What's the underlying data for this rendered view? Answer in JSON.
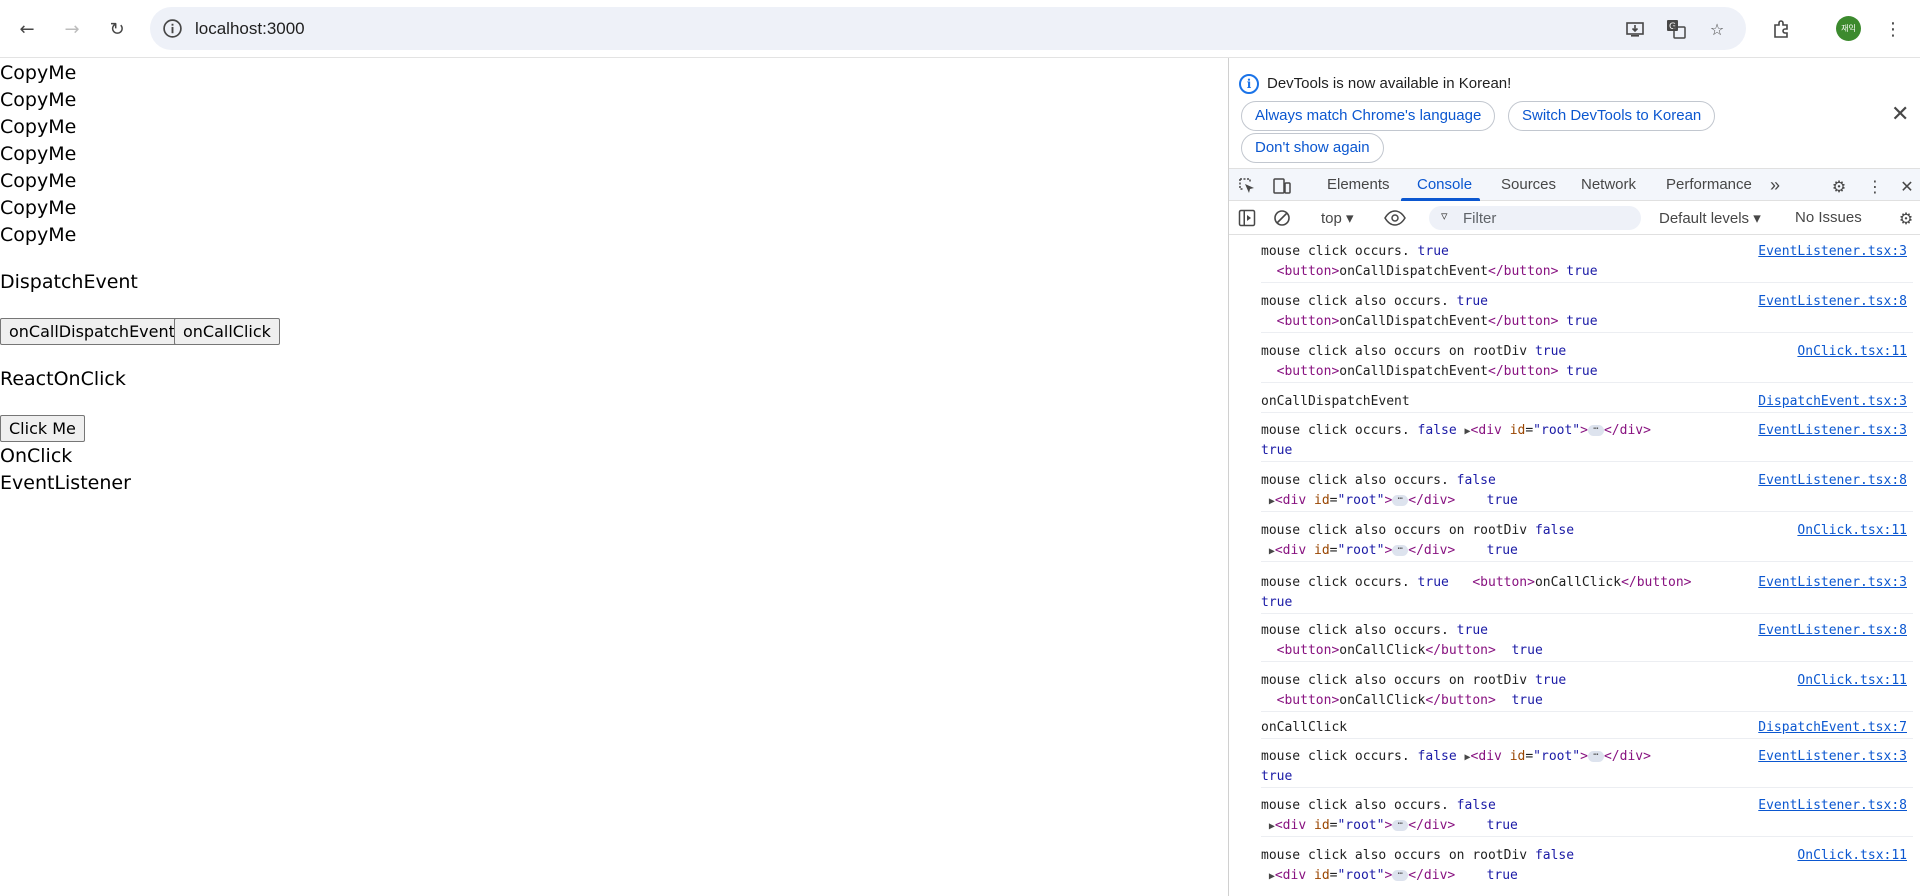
{
  "browser": {
    "url": "localhost:3000",
    "avatar_initials": "재익",
    "icons": [
      "back-arrow-icon",
      "forward-arrow-icon",
      "reload-icon",
      "site-info-icon",
      "install-app-icon",
      "translate-icon",
      "bookmark-star-icon",
      "extensions-icon",
      "kebab-menu-icon"
    ]
  },
  "page": {
    "copy_items": [
      "CopyMe",
      "CopyMe",
      "CopyMe",
      "CopyMe",
      "CopyMe",
      "CopyMe",
      "CopyMe"
    ],
    "dispatch_heading": "DispatchEvent",
    "btn_dispatch": "onCallDispatchEvent",
    "btn_click": "onCallClick",
    "react_heading": "ReactOnClick",
    "btn_click_me": "Click Me",
    "onclick_text": "OnClick",
    "listener_text": "EventListener"
  },
  "devtools": {
    "infobar": {
      "message": "DevTools is now available in Korean!",
      "btn_match": "Always match Chrome's language",
      "btn_switch": "Switch DevTools to Korean",
      "btn_dont_show": "Don't show again"
    },
    "tabs": [
      "Elements",
      "Console",
      "Sources",
      "Network",
      "Performance"
    ],
    "active_tab": "Console",
    "more_tabs": "»",
    "console": {
      "context": "top ▾",
      "filter_placeholder": "Filter",
      "levels": "Default levels ▾",
      "issues": "No Issues"
    },
    "messages": [
      {
        "text": "mouse click occurs. true",
        "line2": "<button>onCallDispatchEvent</button> true",
        "source": "EventListener.tsx:3"
      },
      {
        "text": "mouse click also occurs. true",
        "line2": "<button>onCallDispatchEvent</button> true",
        "source": "EventListener.tsx:8"
      },
      {
        "text": "mouse click also occurs on rootDiv true",
        "line2": "<button>onCallDispatchEvent</button> true",
        "source": "OnClick.tsx:11"
      },
      {
        "text": "onCallDispatchEvent",
        "line2": "",
        "source": "DispatchEvent.tsx:3"
      },
      {
        "text": "mouse click occurs. false ▶<div id=\"root\">⋯</div>",
        "line2": "true",
        "source": "EventListener.tsx:3"
      },
      {
        "text": "mouse click also occurs. false",
        "line2": "▶<div id=\"root\">⋯</div>    true",
        "source": "EventListener.tsx:8"
      },
      {
        "text": "mouse click also occurs on rootDiv false",
        "line2": "▶<div id=\"root\">⋯</div>    true",
        "source": "OnClick.tsx:11"
      },
      {
        "text": "mouse click occurs. true   <button>onCallClick</button>",
        "line2": "true",
        "source": "EventListener.tsx:3"
      },
      {
        "text": "mouse click also occurs. true",
        "line2": "<button>onCallClick</button>  true",
        "source": "EventListener.tsx:8"
      },
      {
        "text": "mouse click also occurs on rootDiv true",
        "line2": "<button>onCallClick</button>  true",
        "source": "OnClick.tsx:11"
      },
      {
        "text": "onCallClick",
        "line2": "",
        "source": "DispatchEvent.tsx:7"
      },
      {
        "text": "mouse click occurs. false ▶<div id=\"root\">⋯</div>",
        "line2": "true",
        "source": "EventListener.tsx:3"
      },
      {
        "text": "mouse click also occurs. false",
        "line2": "▶<div id=\"root\">⋯</div>    true",
        "source": "EventListener.tsx:8"
      },
      {
        "text": "mouse click also occurs on rootDiv false",
        "line2": "▶<div id=\"root\">⋯</div>    true",
        "source": "OnClick.tsx:11"
      }
    ]
  }
}
